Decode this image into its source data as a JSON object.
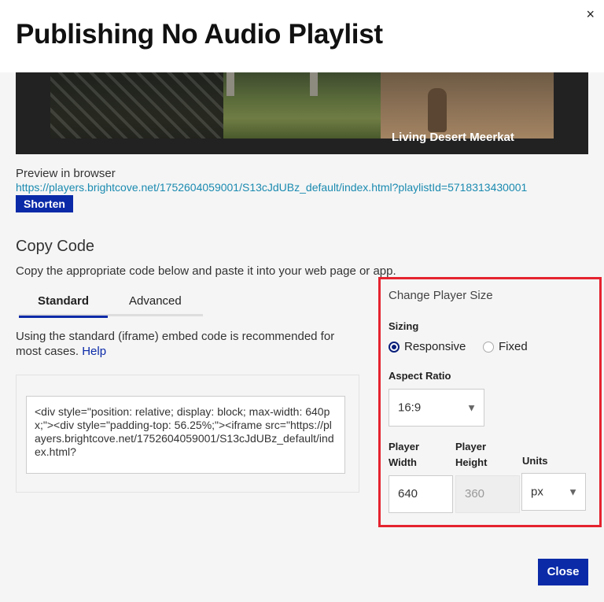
{
  "header": {
    "title": "Publishing No Audio Playlist",
    "close_icon": "×"
  },
  "preview": {
    "video_caption": "Living Desert Meerkat",
    "label": "Preview in browser",
    "url": "https://players.brightcove.net/1752604059001/S13cJdUBz_default/index.html?playlistId=5718313430001",
    "shorten_label": "Shorten"
  },
  "copy": {
    "title": "Copy Code",
    "description": "Copy the appropriate code below and paste it into your web page or app.",
    "tabs": [
      "Standard",
      "Advanced"
    ],
    "note": "Using the standard (iframe) embed code is recommended for most cases.",
    "help_label": "Help",
    "code": "<div style=\"position: relative; display: block; max-width: 640px;\"><div style=\"padding-top: 56.25%;\"><iframe src=\"https://players.brightcove.net/1752604059001/S13cJdUBz_default/index.html?"
  },
  "player_size": {
    "title": "Change Player Size",
    "sizing_label": "Sizing",
    "responsive_label": "Responsive",
    "fixed_label": "Fixed",
    "aspect_label": "Aspect Ratio",
    "aspect_value": "16:9",
    "width_label_1": "Player",
    "width_label_2": "Width",
    "height_label_1": "Player",
    "height_label_2": "Height",
    "units_label": "Units",
    "width_value": "640",
    "height_value": "360",
    "units_value": "px"
  },
  "footer": {
    "close_label": "Close"
  },
  "colors": {
    "primary": "#0a2aa8",
    "link": "#1a8ab0",
    "highlight": "#e5232f"
  }
}
